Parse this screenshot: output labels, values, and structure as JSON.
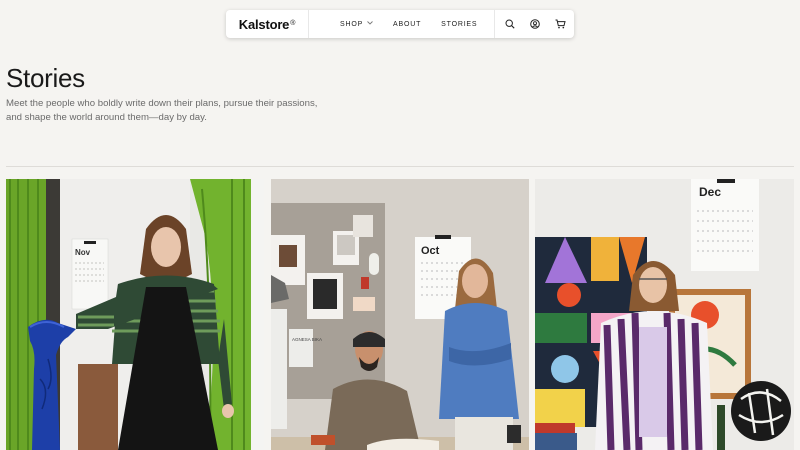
{
  "nav": {
    "brand": "Kalstore",
    "brand_mark": "®",
    "items": [
      {
        "label": "SHOP",
        "has_dropdown": true
      },
      {
        "label": "ABOUT",
        "has_dropdown": false
      },
      {
        "label": "STORIES",
        "has_dropdown": false
      }
    ],
    "icons": [
      "search-icon",
      "account-icon",
      "cart-icon"
    ]
  },
  "hero": {
    "title": "Stories",
    "intro": "Meet the people who boldly write down their plans, pursue their passions, and shape the world around them—day by day."
  },
  "cards": [
    {
      "calendar_month": "Nov"
    },
    {
      "calendar_month": "Oct",
      "book_title": "AGNESA BIKA"
    },
    {
      "calendar_month": "Dec"
    }
  ],
  "colors": {
    "background": "#f5f4f1",
    "nav_bg": "#ffffff",
    "text": "#1f1f1f",
    "muted": "#6b6b6b"
  }
}
